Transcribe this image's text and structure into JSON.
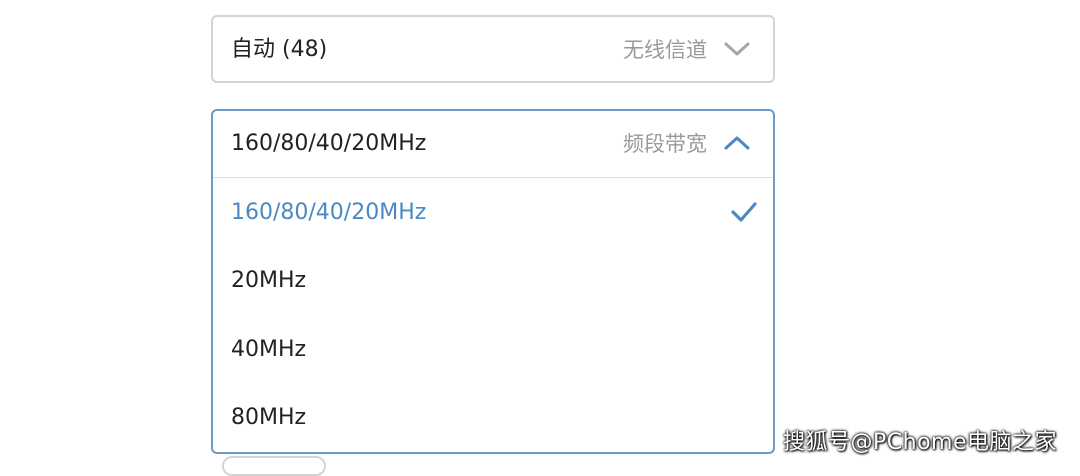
{
  "channel": {
    "value": "自动 (48)",
    "hint": "无线信道",
    "icon": "chevron-down-icon"
  },
  "bandwidth": {
    "value": "160/80/40/20MHz",
    "hint": "频段带宽",
    "icon": "chevron-up-icon",
    "options": [
      {
        "label": "160/80/40/20MHz",
        "selected": true
      },
      {
        "label": "20MHz",
        "selected": false
      },
      {
        "label": "40MHz",
        "selected": false
      },
      {
        "label": "80MHz",
        "selected": false
      }
    ]
  },
  "watermark": "搜狐号@PChome电脑之家",
  "colors": {
    "accent": "#4b88c5",
    "border": "#d4d4d4",
    "active_border": "#6e9bc5",
    "hint_text": "#9a9a9a"
  }
}
